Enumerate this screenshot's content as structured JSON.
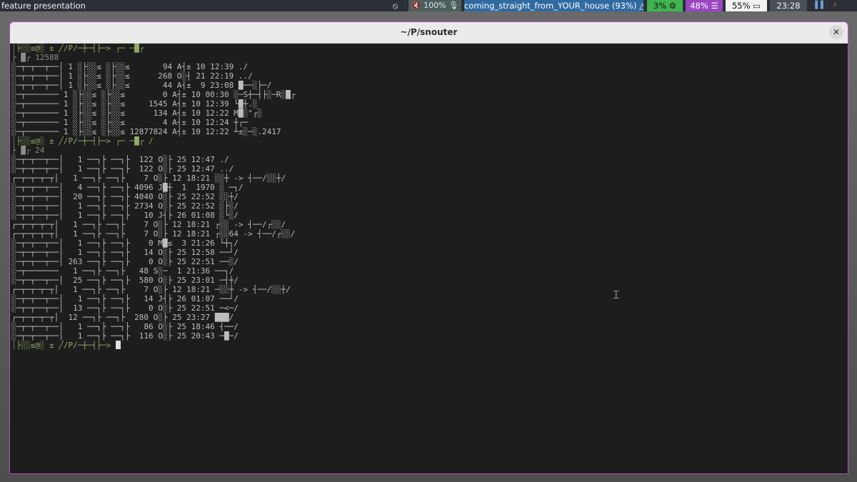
{
  "topbar": {
    "title": "feature presentation",
    "hidden_icon": "eye-slash-icon",
    "volume": "🔇 100% 🎙",
    "wifi": "coming_straight_from_YOUR_house (93%) △",
    "cpu": "3% ⚙",
    "mem": "48% ☰",
    "battery": "55% ▭",
    "clock": "23:28",
    "tray1": "▐▐",
    "tray2": "⚡"
  },
  "colors": {
    "bar_bg": "#2b2f36",
    "volume_bg": "#4b5f5e",
    "wifi_bg": "#2f6aa0",
    "cpu_bg": "#3fb34f",
    "mem_bg": "#9a46c2",
    "battery_bg": "#f2f2f2",
    "clock_bg": "#4a4f58",
    "window_border": "#b34fc0",
    "terminal_bg": "#1d1d1d"
  },
  "window": {
    "title": "~/P/snouter",
    "close_icon": "✕"
  },
  "terminal": {
    "lines": [
      "┊├░░≤@░ ± ╱/P/─┼─┤├─> ┌─ ─█┌",
      "├ █┌ 12588",
      "░─┬─┬──┬──│ 1 ░├░░≤ ░├░░≤       94 A┤± 10 12:39 ./",
      "░─┬─┬──┬──│ 1 ░├░░≤ ░├░░≤      268 O░┤ 21 22:19 ../",
      "░─┬─┬──┬──│ 1 ░├░░≤ ░├░░≤       44 A┤±  9 23:08 █──░├─/",
      "░─┬─────── 1 ░├░░≤ ░├░░≤        0 A┤± 10 00:30 ░─S┼─┤├░─R░█┌",
      "░─┬─────── 1 ░├░░≤ ░├░░≤     1545 A┤± 10 12:39 └█┼.░",
      "░─┬─────── 1 ░├░░≤ ░├░░≤      134 A┤± 10 12:22 M█░°┌░",
      "░─┬─────── 1 ░├░░≤ ░├░░≤        4 A┤± 10 12:24 ┼┌─",
      "░─┬─────── 1 ░├░░≤ ░├░░≤ 12877824 A┤± 10 12:22 ┴±░─░.2417",
      "┊├░░≤@░ ± ╱/P/─┼─┤├─> ┌─ ─█┌ /",
      "├ █┌ 24",
      "░─┬─┬──┬──│   1 ──┐├ ──┐├  122 O░├ 25 12:47 ./",
      "░─┬─┬──┬──│   1 ──┐├ ──┐├  122 O░├ 25 12:47 ../",
      "┌─┬─┬─┬─┬│   1 ──┐├ ──┐├    7 O░├ 12 18:21 ░░┼ -> ┤──/░░┼/",
      "░─┬─┬──┬──│   4 ──┐├ ──┐├ 4096 J█┼  1  1970 ░ ─┐/",
      "░─┬─┬──┬──│  20 ──┐├ ──┐├ 4040 O░├ 25 22:52 ░░┼/",
      "░─┬─┬──┬──│   1 ──┐├ ──┐├ 2734 O░├ 25 22:52 ░├░/",
      "░─┬─┬──┬──│   1 ──┐├ ──┐├   10 J┤├ 26 01:08 ░└░/",
      "┌─┬─┬─┬─┬│   1 ──┐├ ──┐├    7 O░├ 12 18:21 ┌░░ -> ┤──/┌░░/",
      "┌─┬─┬─┬─┬│   1 ──┐├ ──┐├    7 O░├ 12 18:21 ┌░░64 -> ┤──/┌░░/",
      "░─┬─┬──┬──│   1 ──┐├ ──┐├    0 M█≤  3 21:26 └┼┐/",
      "░─┬─┬──┬──│   1 ──┐├ ──┐├   14 O░├ 25 12:58 ──┘/",
      "░─┬─┬──┬──│ 263 ──┐├ ──┐├    0 O░├ 25 22:51 ──░/",
      "░─┬───────   1 ──┐├ ──┐├   48 S░─  1 21:36 ──┐/",
      "░─┬─┬──┬──│  25 ──┐├ ──┐├  580 O░├ 25 23:01 ─┤┼/",
      "┌─┬─┬─┬─┬│   1 ──┐├ ──┐├    7 O░├ 12 18:21 ─░░┼ -> ┤──/░░┼/",
      "░─┬─┬──┬──│   1 ──┐├ ──┐├   14 J┤├ 26 01:07 ──┘/",
      "░─┬─┬──┬──│  13 ──┐├ ──┐├    0 O░├ 25 22:51 ─<─/",
      "┌─┬─┬─┬─┬│  12 ──┐├ ──┐├  280 O░├ 25 23:27 ███/",
      "░─┬─┬──┬──│   1 ──┐├ ──┐├   86 O░├ 25 18:46 ┤──/",
      "░─┬─┬──┬──│   1 ──┐├ ──┐├  116 O░├ 25 20:43 ─█─/",
      "┊├░░≤@░ ± ╱/P/─┼─┤├─> "
    ]
  }
}
